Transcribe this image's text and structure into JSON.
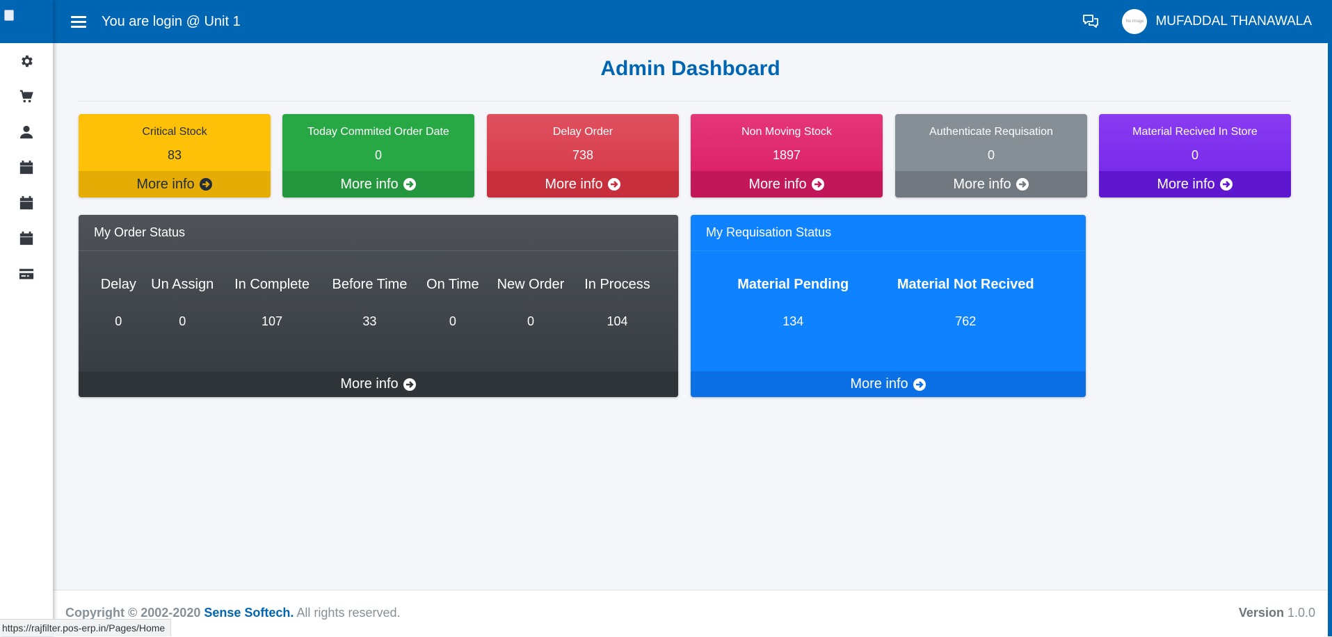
{
  "topbar": {
    "login_text": "You are login @ Unit 1",
    "user_name": "MUFADDAL THANAWALA",
    "avatar_text": "No Image"
  },
  "sidebar": {
    "icons": [
      "gear-icon",
      "cart-icon",
      "user-icon",
      "calendar-icon",
      "calendar-icon",
      "calendar-icon",
      "credit-card-icon"
    ]
  },
  "page": {
    "title": "Admin Dashboard"
  },
  "small_boxes": [
    {
      "title": "Critical Stock",
      "value": "83",
      "footer": "More info",
      "color": "#ffc107"
    },
    {
      "title": "Today Commited Order Date",
      "value": "0",
      "footer": "More info",
      "color": "#28a745"
    },
    {
      "title": "Delay Order",
      "value": "738",
      "footer": "More info",
      "color": "#dc3545"
    },
    {
      "title": "Non Moving Stock",
      "value": "1897",
      "footer": "More info",
      "color": "#e83e8c"
    },
    {
      "title": "Authenticate Requisation",
      "value": "0",
      "footer": "More info",
      "color": "#6c757d"
    },
    {
      "title": "Material Recived In Store",
      "value": "0",
      "footer": "More info",
      "color": "#6f42c1"
    }
  ],
  "order_status": {
    "title": "My Order Status",
    "columns": [
      "Delay",
      "Un Assign",
      "In Complete",
      "Before Time",
      "On Time",
      "New Order",
      "In Process"
    ],
    "values": [
      "0",
      "0",
      "107",
      "33",
      "0",
      "0",
      "104"
    ],
    "footer": "More info"
  },
  "requisation_status": {
    "title": "My Requisation Status",
    "columns": [
      "Material Pending",
      "Material Not Recived"
    ],
    "values": [
      "134",
      "762"
    ],
    "footer": "More info"
  },
  "footer": {
    "copyright": "Copyright © 2002-2020",
    "company": "Sense Softech.",
    "rights": "All rights reserved.",
    "version_label": "Version",
    "version_value": "1.0.0"
  },
  "status_bar": {
    "url": "https://rajfilter.pos-erp.in/Pages/Home"
  }
}
